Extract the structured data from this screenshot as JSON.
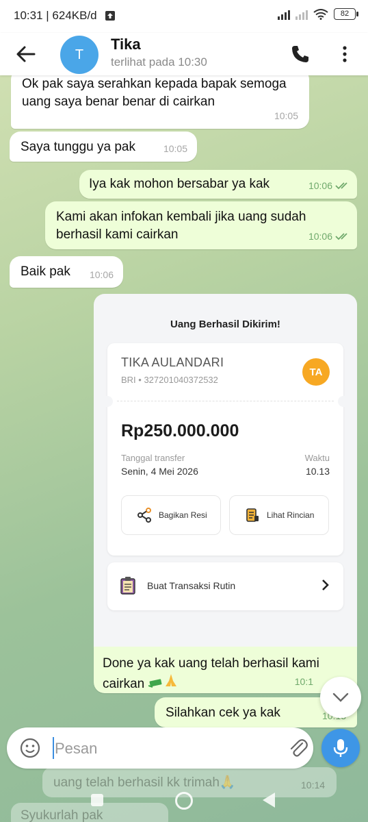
{
  "status_bar": {
    "time_speed": "10:31 | 624KB/d",
    "battery": "82"
  },
  "header": {
    "name": "Tika",
    "avatar_letter": "T",
    "last_seen": "terlihat pada  10:30"
  },
  "messages": [
    {
      "dir": "in",
      "text": "Ok pak saya serahkan kepada bapak semoga uang saya benar benar di cairkan",
      "time": "10:05"
    },
    {
      "dir": "in",
      "text": "Saya tunggu ya pak",
      "time": "10:05"
    },
    {
      "dir": "out",
      "text": "Iya kak mohon bersabar ya kak",
      "time": "10:06"
    },
    {
      "dir": "out",
      "text": "Kami akan infokan kembali jika uang sudah berhasil kami cairkan",
      "time": "10:06"
    },
    {
      "dir": "in",
      "text": "Baik pak",
      "time": "10:06"
    },
    {
      "dir": "out",
      "text": "Done ya kak uang telah berhasil kami cairkan",
      "time": "10:1"
    },
    {
      "dir": "out",
      "text": "Silahkan cek ya kak",
      "time": "10:13"
    }
  ],
  "receipt": {
    "title": "Uang Berhasil Dikirim!",
    "name": "TIKA AULANDARI",
    "account": "BRI • 327201040372532",
    "badge": "TA",
    "amount": "Rp250.000.000",
    "date_label": "Tanggal transfer",
    "date_value": "Senin, 4 Mei 2026",
    "time_label": "Waktu",
    "time_value": "10.13",
    "share_label": "Bagikan Resi",
    "details_label": "Lihat Rincian",
    "routine_label": "Buat Transaksi Rutin"
  },
  "composer": {
    "placeholder": "Pesan"
  },
  "behind": {
    "msg1": "uang telah berhasil kk trimah🙏",
    "msg1_time": "10:14",
    "msg2": "Syukurlah pak"
  },
  "colors": {
    "accent": "#3e96e6",
    "out_bubble": "#eefed8",
    "badge": "#f7a823"
  }
}
